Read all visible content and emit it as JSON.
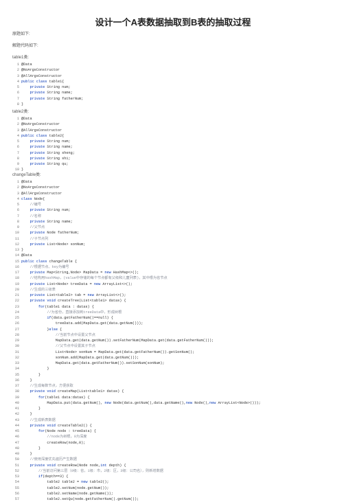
{
  "doc": {
    "title": "设计一个A表数据抽取到B表的抽取过程",
    "paragraphs": [
      "原题如下:",
      "解题代码如下:"
    ],
    "sections": [
      {
        "label": "table1类:",
        "lines": [
          "1 @Data",
          "2 @NoArgsConstructor",
          "3 @AllArgsConstructor",
          "4 public class table1{",
          "5     private String num;",
          "6     private String name;",
          "7     private String fatherNum;",
          "8 }"
        ]
      },
      {
        "label": "table2类:",
        "lines": [
          " 1 @Data",
          " 2 @NoArgsConstructor",
          " 3 @AllArgsConstructor",
          " 4 public class table2{",
          " 5     private String num;",
          " 6     private String name;",
          " 7     private String sheng;",
          " 8     private String shi;",
          " 9     private String qu;",
          "10 }"
        ]
      },
      {
        "label": "changeTable类:",
        "lines": [
          " 1 @Data",
          " 2 @NoArgsConstructor",
          " 3 @AllArgsConstructor",
          " 4 class Node{",
          " 5     //编号",
          " 6     private String num;",
          " 7     //名称",
          " 8     private String name;",
          " 9     //父节点",
          "10     private Node fatherNum;",
          "11     //子节点列",
          "12     private List<Node> sonNum;",
          "13 }",
          "14 @Data",
          "15 public class changeTable {",
          "16     //根据节点、key为编号",
          "17     private Map<String,Node> MapData = new HashMap<>();",
          "18     //结构用hashMap，(value中存储的每个节点都有父级和儿童列表)，其中根为省节点",
          "19     private List<Node> treeData = new ArrayList<>();",
          "20     //生成的三级表",
          "21     private List<table2> tab = new ArrayList<>();",
          "22     private void createTree(List<table1> datas) {",
          "23         for(table1 data : datas) {",
          "24             //为省份，直接添加到treeData中，形成树根",
          "25             if(data.getFatherNum()==null) {",
          "26                 treeData.add(MapData.get(data.getNum()));",
          "27             }else {",
          "28                 //当前节点中设置父节点",
          "29                 MapData.get(data.getNum()).setFatherNum(MapData.get(data.getFatherNum()));",
          "30                 //父节点中设置其子节点",
          "31                 List<Node> sonNum = MapData.get(data.getFatherNum()).getSonNum();",
          "32                 sonNum.add(MapData.get(data.getNum()));",
          "33                 MapData.get(data.getFatherNum()).setSonNum(sonNum);",
          "34             }",
          "35         }",
          "36     }",
          "37     //生成每数节点，方便获取",
          "38     private void createMap(List<table1> datas) {",
          "39         for(table1 data:datas) {",
          "40             MapData.put(data.getNum(), new Node(data.getNum(),data.getName(),new Node(),new ArrayList<Node>()));",
          "41         }",
          "42     }",
          "43     //生成新表数据",
          "44     private void createTable2() {",
          "45         for(Node node : treeData) {",
          "46             //node为树根，0为深度",
          "47             createRow(node,0);",
          "48         }",
          "49     }",
          "50     //使用深度优先遍历产生数据",
          "51     private void createRow(Node node,int depth) {",
          "52         //当前访问第三层（0级：省，1级：市，2级：区，3级：公司名），则新增数据",
          "53         if(depth==3) {",
          "54             table2 table2 = new table2();",
          "55             table2.setNum(node.getNum());",
          "56             table2.setName(node.getName());",
          "57             table2.setQu(node.getFatherNum().getNum());"
        ]
      }
    ]
  }
}
